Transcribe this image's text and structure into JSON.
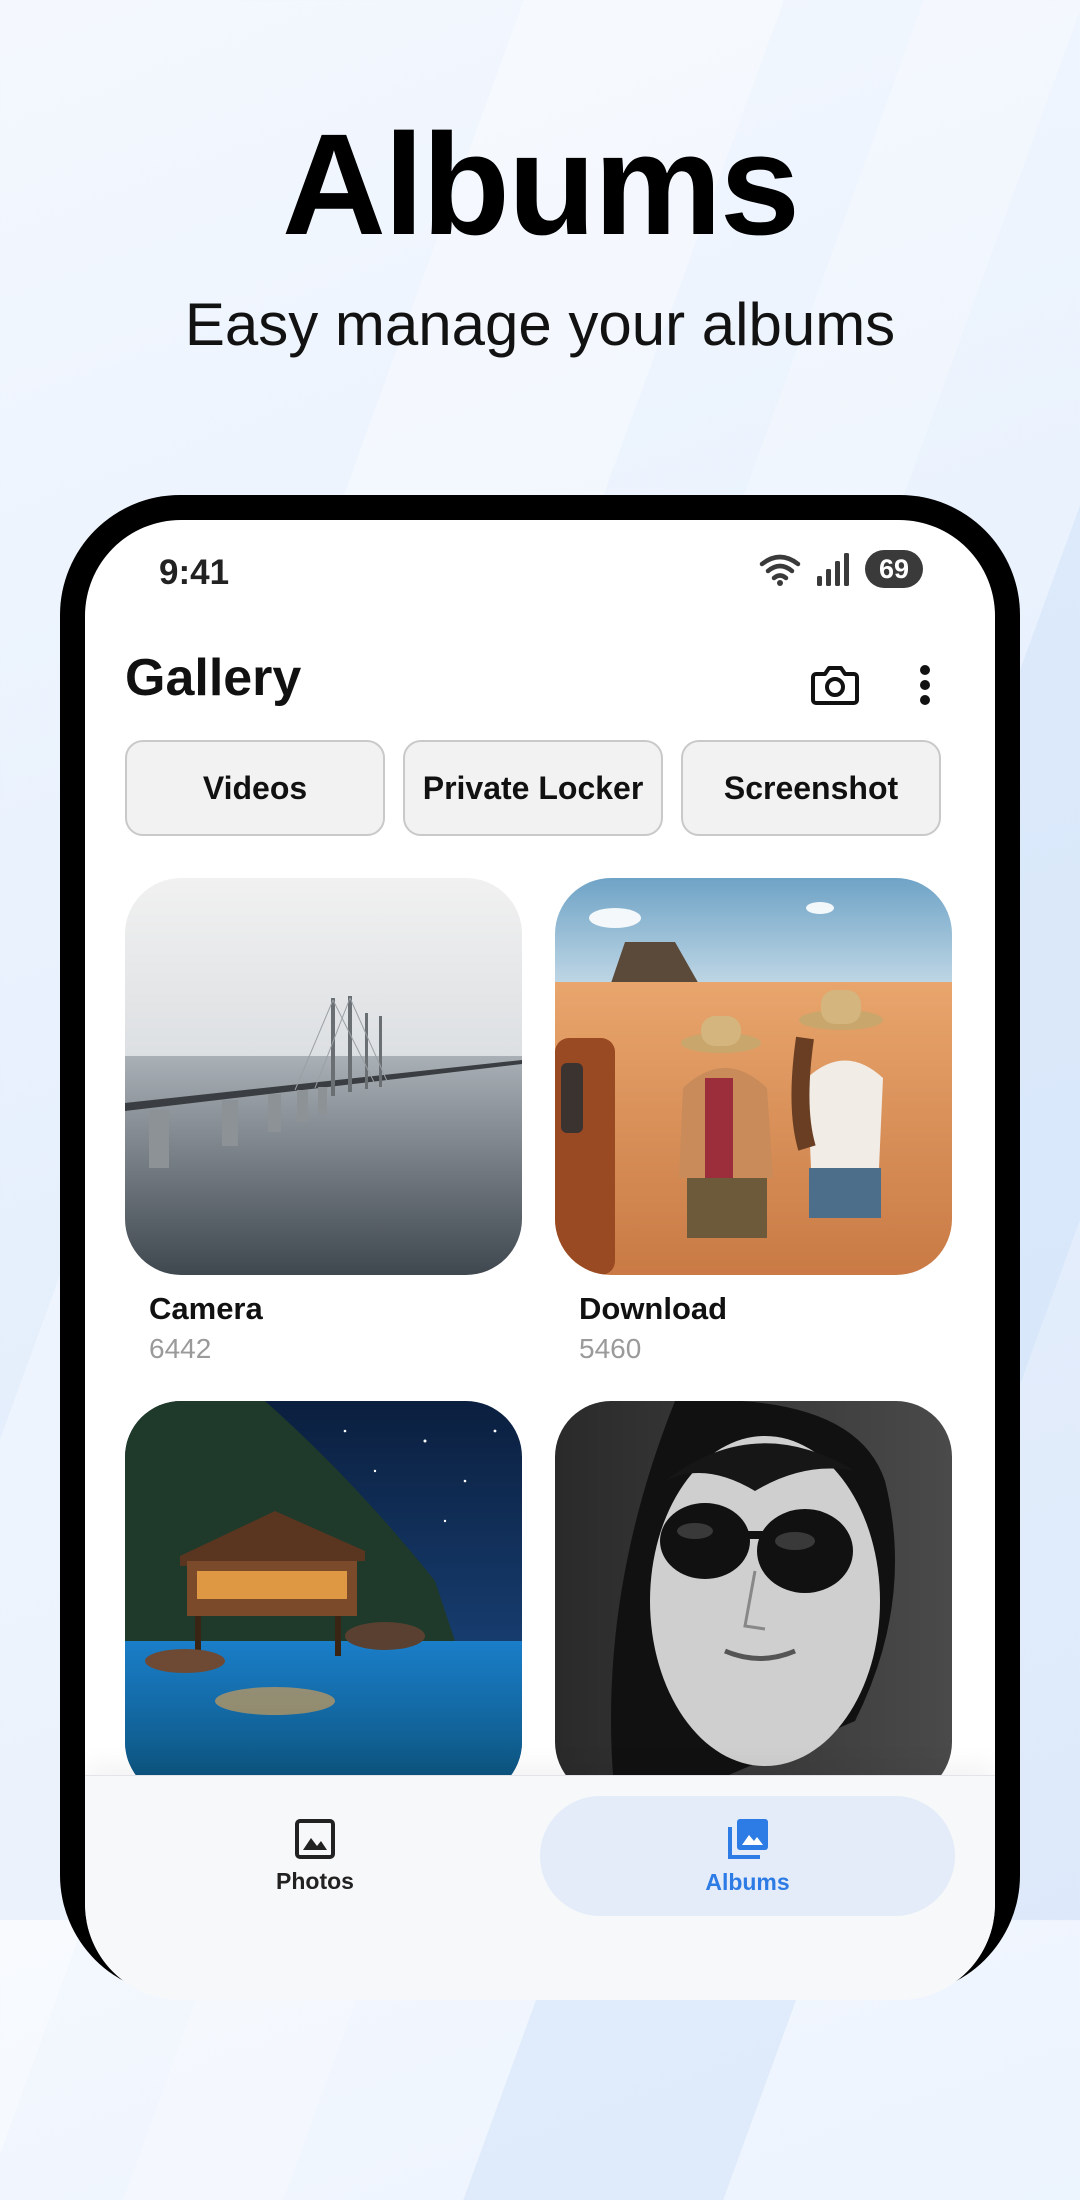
{
  "hero": {
    "title": "Albums",
    "subtitle": "Easy manage your albums"
  },
  "status_bar": {
    "time": "9:41",
    "battery": "69",
    "icons": [
      "wifi-icon",
      "signal-icon",
      "battery-icon"
    ]
  },
  "app_bar": {
    "title": "Gallery",
    "actions": [
      "camera-icon",
      "more-vert-icon"
    ]
  },
  "chips": [
    {
      "label": "Videos"
    },
    {
      "label": "Private Locker"
    },
    {
      "label": "Screenshot"
    }
  ],
  "albums": [
    {
      "name": "Camera",
      "count": "6442"
    },
    {
      "name": "Download",
      "count": "5460"
    },
    {
      "name": "",
      "count": ""
    },
    {
      "name": "",
      "count": ""
    }
  ],
  "bottom_nav": {
    "items": [
      {
        "label": "Photos",
        "icon": "image-icon",
        "active": false
      },
      {
        "label": "Albums",
        "icon": "photo-library-icon",
        "active": true
      }
    ]
  },
  "colors": {
    "accent": "#2d7be5",
    "active_pill": "#e3ecf8",
    "inactive_icon": "#222222"
  }
}
